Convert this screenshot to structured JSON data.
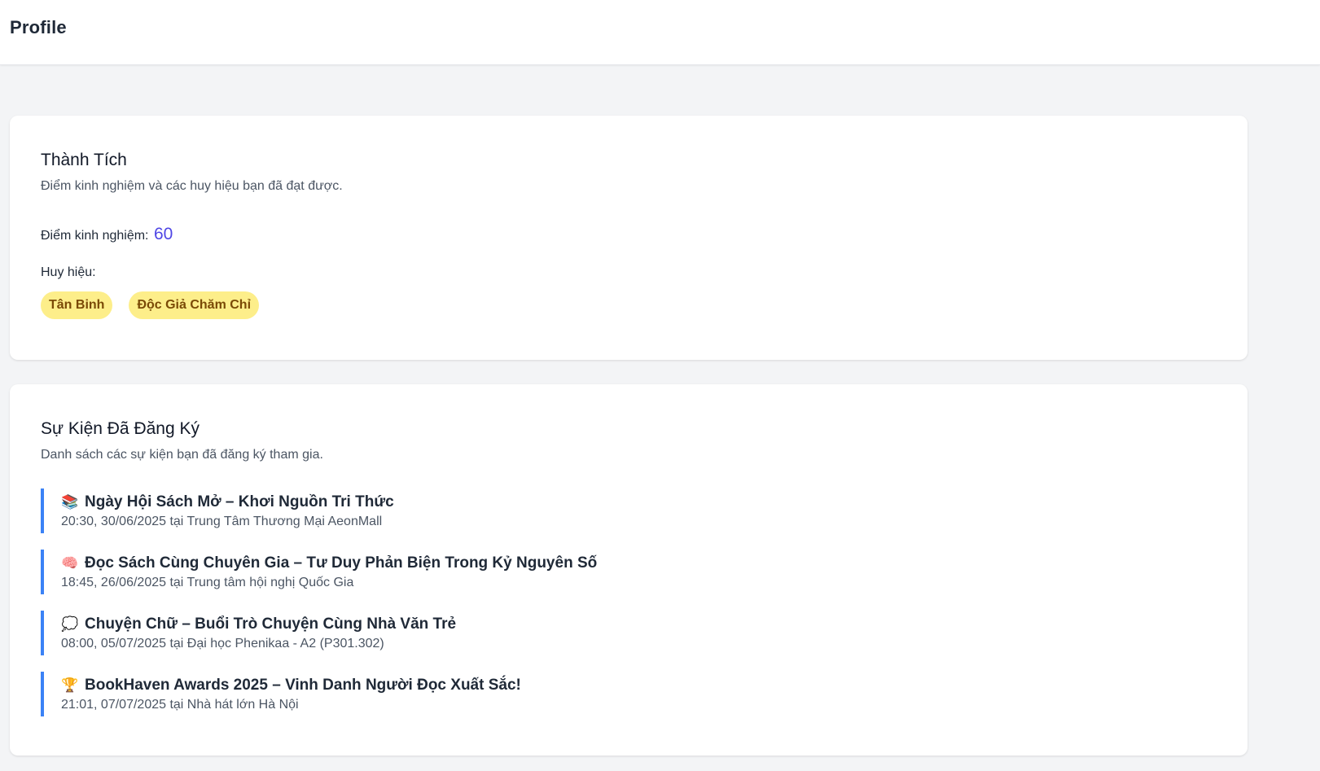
{
  "header": {
    "title": "Profile"
  },
  "achievements": {
    "title": "Thành Tích",
    "subtitle": "Điểm kinh nghiệm và các huy hiệu bạn đã đạt được.",
    "xp_label": "Điểm kinh nghiệm:",
    "xp_value": "60",
    "badges_label": "Huy hiệu:",
    "badges": [
      {
        "label": "Tân Binh"
      },
      {
        "label": "Độc Giả Chăm Chỉ"
      }
    ]
  },
  "events": {
    "title": "Sự Kiện Đã Đăng Ký",
    "subtitle": "Danh sách các sự kiện bạn đã đăng ký tham gia.",
    "items": [
      {
        "icon": "books-icon",
        "glyph": "📚",
        "title": "Ngày Hội Sách Mở – Khơi Nguồn Tri Thức",
        "meta": "20:30, 30/06/2025 tại Trung Tâm Thương Mại AeonMall"
      },
      {
        "icon": "brain-icon",
        "glyph": "🧠",
        "title": "Đọc Sách Cùng Chuyên Gia – Tư Duy Phản Biện Trong Kỷ Nguyên Số",
        "meta": "18:45, 26/06/2025 tại Trung tâm hội nghị Quốc Gia"
      },
      {
        "icon": "speech-bubble-icon",
        "glyph": "💭",
        "title": "Chuyện Chữ – Buổi Trò Chuyện Cùng Nhà Văn Trẻ",
        "meta": "08:00, 05/07/2025 tại Đại học Phenikaa - A2 (P301.302)"
      },
      {
        "icon": "trophy-icon",
        "glyph": "🏆",
        "title": "BookHaven Awards 2025 – Vinh Danh Người Đọc Xuất Sắc!",
        "meta": "21:01, 07/07/2025 tại Nhà hát lớn Hà Nội"
      }
    ]
  },
  "colors": {
    "accent": "#4f46e5",
    "event_border": "#3b82f6",
    "badge_bg": "#fdee8a",
    "badge_text": "#7a4a06"
  }
}
